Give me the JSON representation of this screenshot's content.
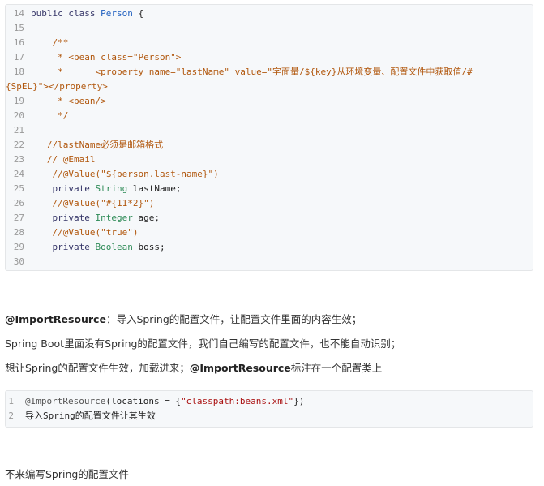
{
  "code_block_1": {
    "lines": [
      {
        "n": "14",
        "parts": [
          {
            "t": "public class ",
            "c": "kw"
          },
          {
            "t": "Person",
            "c": "cls"
          },
          {
            "t": " {",
            "c": "plain"
          }
        ]
      },
      {
        "n": "15",
        "parts": []
      },
      {
        "n": "16",
        "parts": [
          {
            "t": "    /**",
            "c": "comment"
          }
        ]
      },
      {
        "n": "17",
        "parts": [
          {
            "t": "     * <bean class=\"Person\">",
            "c": "comment"
          }
        ]
      },
      {
        "n": "18",
        "parts": [
          {
            "t": "     *      <property name=\"lastName\" value=\"字面量/${key}从环境变量、配置文件中获取值/#",
            "c": "comment"
          }
        ]
      },
      {
        "n": "",
        "parts": [
          {
            "t": "{SpEL}\"></property>",
            "c": "comment"
          }
        ]
      },
      {
        "n": "19",
        "parts": [
          {
            "t": "     * <bean/>",
            "c": "comment"
          }
        ]
      },
      {
        "n": "20",
        "parts": [
          {
            "t": "     */",
            "c": "comment"
          }
        ]
      },
      {
        "n": "21",
        "parts": []
      },
      {
        "n": "22",
        "parts": [
          {
            "t": "   //lastName必须是邮箱格式",
            "c": "comment"
          }
        ]
      },
      {
        "n": "23",
        "parts": [
          {
            "t": "   // @Email",
            "c": "comment"
          }
        ]
      },
      {
        "n": "24",
        "parts": [
          {
            "t": "    //@Value(\"${person.last-name}\")",
            "c": "comment"
          }
        ]
      },
      {
        "n": "25",
        "parts": [
          {
            "t": "    private ",
            "c": "kw"
          },
          {
            "t": "String",
            "c": "type"
          },
          {
            "t": " lastName;",
            "c": "plain"
          }
        ]
      },
      {
        "n": "26",
        "parts": [
          {
            "t": "    //@Value(\"#{11*2}\")",
            "c": "comment"
          }
        ]
      },
      {
        "n": "27",
        "parts": [
          {
            "t": "    private ",
            "c": "kw"
          },
          {
            "t": "Integer",
            "c": "type"
          },
          {
            "t": " age;",
            "c": "plain"
          }
        ]
      },
      {
        "n": "28",
        "parts": [
          {
            "t": "    //@Value(\"true\")",
            "c": "comment"
          }
        ]
      },
      {
        "n": "29",
        "parts": [
          {
            "t": "    private ",
            "c": "kw"
          },
          {
            "t": "Boolean",
            "c": "type"
          },
          {
            "t": " boss;",
            "c": "plain"
          }
        ]
      },
      {
        "n": "30",
        "parts": []
      }
    ]
  },
  "paragraphs": {
    "p1_bold": "@ImportResource",
    "p1_rest": "：导入Spring的配置文件，让配置文件里面的内容生效；",
    "p2": "Spring Boot里面没有Spring的配置文件，我们自己编写的配置文件，也不能自动识别；",
    "p3_a": "想让Spring的配置文件生效，加载进来；",
    "p3_bold": "@ImportResource",
    "p3_b": "标注在一个配置类上",
    "p4": "不来编写Spring的配置文件"
  },
  "code_block_2": {
    "lines": [
      {
        "n": "1",
        "parts": [
          {
            "t": "@ImportResource",
            "c": "ann"
          },
          {
            "t": "(locations = {",
            "c": "plain"
          },
          {
            "t": "\"classpath:beans.xml\"",
            "c": "str"
          },
          {
            "t": "})",
            "c": "plain"
          }
        ]
      },
      {
        "n": "2",
        "parts": [
          {
            "t": "导入Spring的配置文件让其生效",
            "c": "plain"
          }
        ]
      }
    ]
  }
}
